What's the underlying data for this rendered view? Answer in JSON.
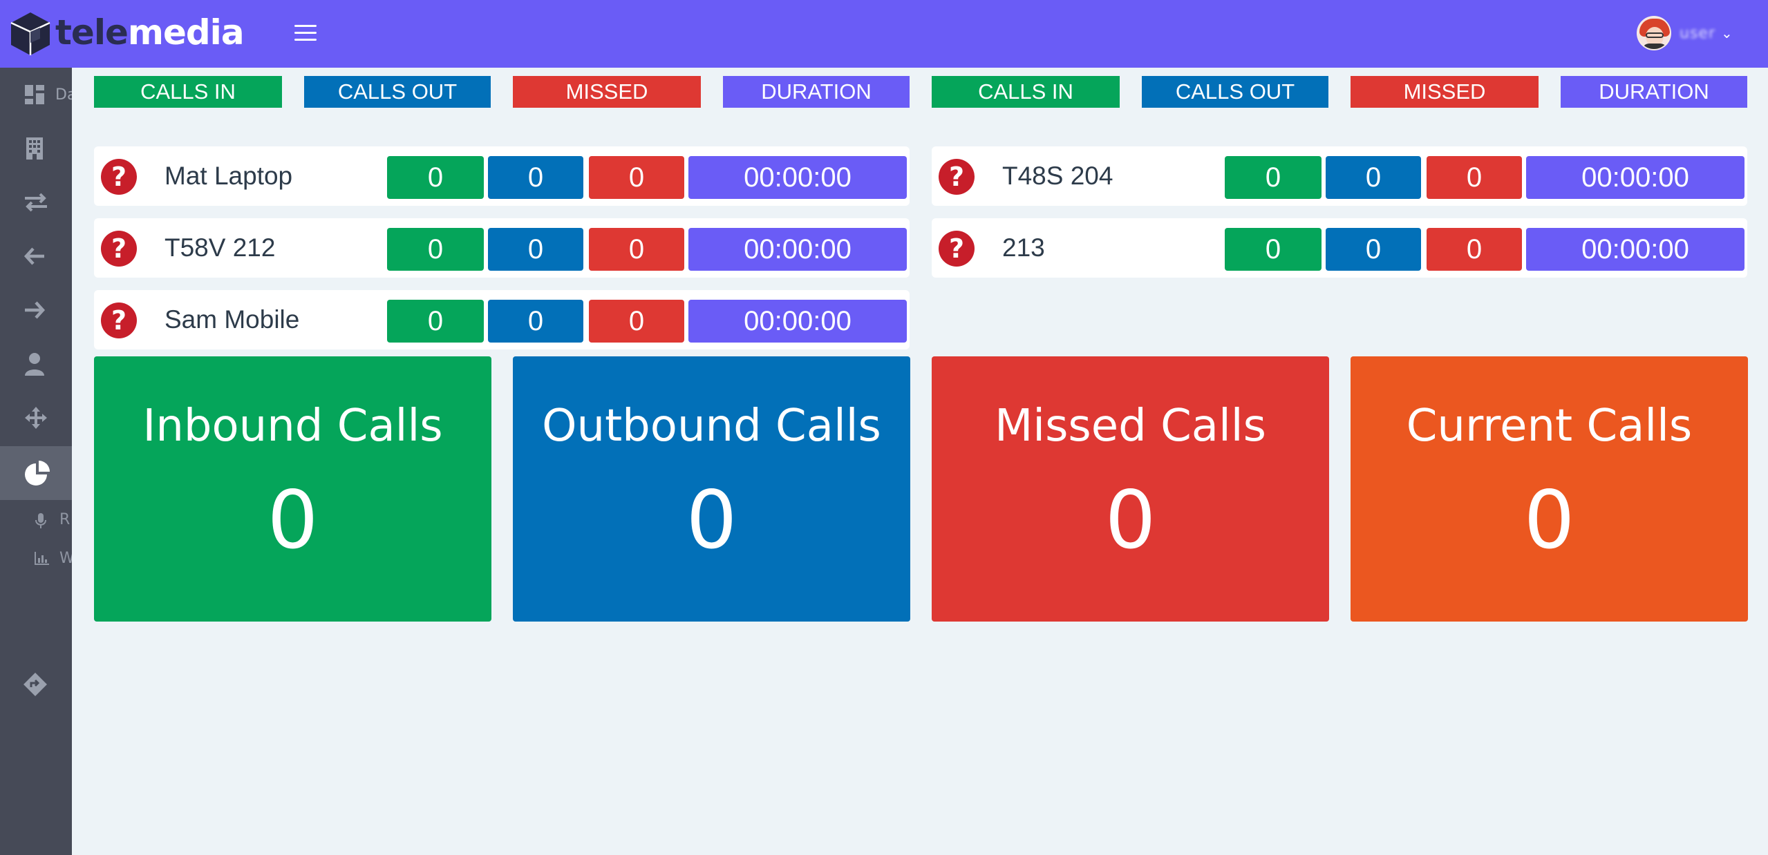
{
  "brand": {
    "name_part1": "tele",
    "name_part2": "media",
    "accent": "#6a5cf6"
  },
  "user": {
    "name": "user"
  },
  "sidebar": {
    "items": [
      {
        "icon": "dashboard-icon",
        "label": "Da"
      },
      {
        "icon": "building-icon",
        "label": ""
      },
      {
        "icon": "transfer-icon",
        "label": ""
      },
      {
        "icon": "arrow-left-icon",
        "label": ""
      },
      {
        "icon": "arrow-right-icon",
        "label": ""
      },
      {
        "icon": "user-icon",
        "label": ""
      },
      {
        "icon": "move-icon",
        "label": ""
      },
      {
        "icon": "pie-chart-icon",
        "label": "",
        "active": true
      },
      {
        "icon": "directions-icon",
        "label": ""
      }
    ],
    "subitems": [
      {
        "icon": "microphone-icon",
        "label": "R"
      },
      {
        "icon": "bar-chart-icon",
        "label": "W"
      }
    ]
  },
  "headers": {
    "left": [
      "CALLS IN",
      "CALLS OUT",
      "MISSED",
      "DURATION"
    ],
    "right": [
      "CALLS IN",
      "CALLS OUT",
      "MISSED",
      "DURATION"
    ]
  },
  "extensions": [
    {
      "name": "Mat Laptop",
      "status_icon": "?",
      "calls_in": "0",
      "calls_out": "0",
      "missed": "0",
      "duration": "00:00:00"
    },
    {
      "name": "T48S 204",
      "status_icon": "?",
      "calls_in": "0",
      "calls_out": "0",
      "missed": "0",
      "duration": "00:00:00"
    },
    {
      "name": "T58V 212",
      "status_icon": "?",
      "calls_in": "0",
      "calls_out": "0",
      "missed": "0",
      "duration": "00:00:00"
    },
    {
      "name": "213",
      "status_icon": "?",
      "calls_in": "0",
      "calls_out": "0",
      "missed": "0",
      "duration": "00:00:00"
    },
    {
      "name": "Sam Mobile",
      "status_icon": "?",
      "calls_in": "0",
      "calls_out": "0",
      "missed": "0",
      "duration": "00:00:00"
    }
  ],
  "cards": [
    {
      "title": "Inbound Calls",
      "value": "0",
      "color": "#05a55a"
    },
    {
      "title": "Outbound Calls",
      "value": "0",
      "color": "#0270b8"
    },
    {
      "title": "Missed Calls",
      "value": "0",
      "color": "#de3833"
    },
    {
      "title": "Current Calls",
      "value": "0",
      "color": "#eb5720"
    }
  ],
  "colors": {
    "calls_in": "#05a55a",
    "calls_out": "#0270b8",
    "missed": "#de3833",
    "duration": "#6a5cf6",
    "current": "#eb5720",
    "status_unknown": "#c71e2a"
  }
}
